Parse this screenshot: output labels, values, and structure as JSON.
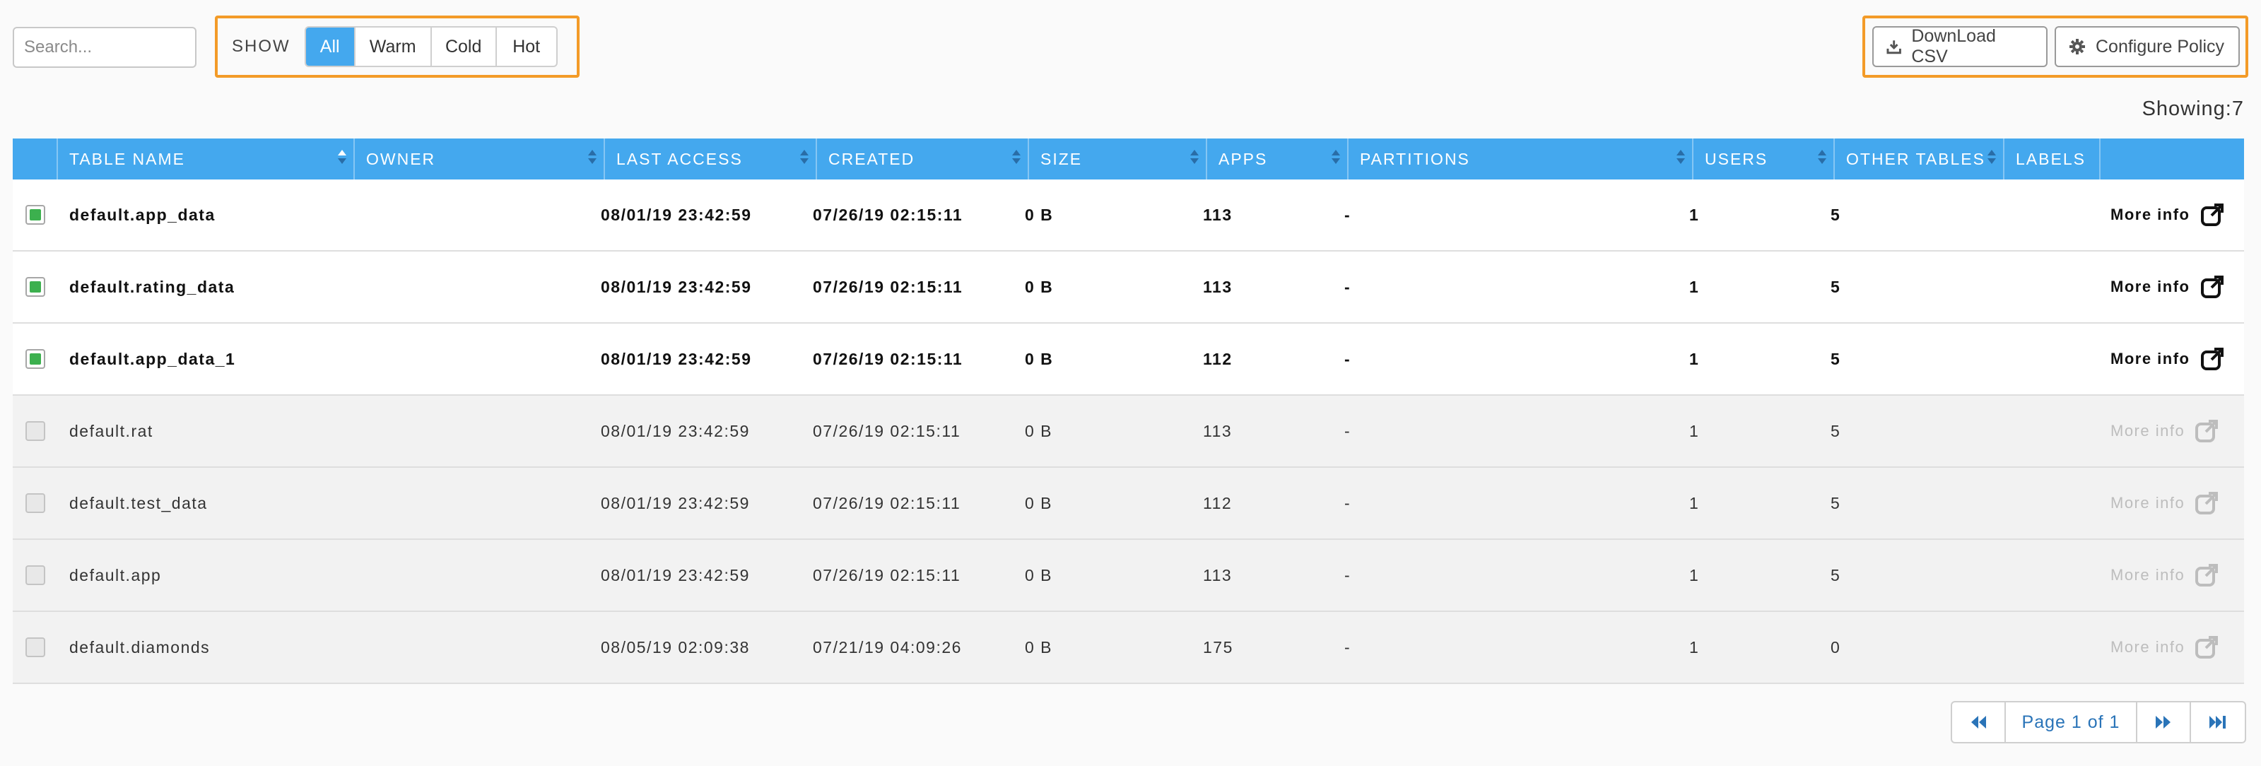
{
  "toolbar": {
    "search_placeholder": "Search...",
    "show_label": "SHOW",
    "filters": [
      {
        "label": "All",
        "active": true
      },
      {
        "label": "Warm",
        "active": false
      },
      {
        "label": "Cold",
        "active": false
      },
      {
        "label": "Hot",
        "active": false
      }
    ],
    "download_label": "DownLoad CSV",
    "configure_label": "Configure Policy",
    "download_icon": "download-icon",
    "configure_icon": "gear-icon"
  },
  "showing": "Showing:7",
  "table": {
    "columns": [
      "TABLE NAME",
      "OWNER",
      "LAST ACCESS",
      "CREATED",
      "SIZE",
      "APPS",
      "PARTITIONS",
      "USERS",
      "OTHER TABLES",
      "LABELS"
    ],
    "more_info_label": "More info",
    "rows": [
      {
        "selected": true,
        "name": "default.app_data",
        "owner": "",
        "last_access": "08/01/19 23:42:59",
        "created": "07/26/19 02:15:11",
        "size": "0 B",
        "apps": "113",
        "partitions": "-",
        "users": "1",
        "other_tables": "5",
        "labels": ""
      },
      {
        "selected": true,
        "name": "default.rating_data",
        "owner": "",
        "last_access": "08/01/19 23:42:59",
        "created": "07/26/19 02:15:11",
        "size": "0 B",
        "apps": "113",
        "partitions": "-",
        "users": "1",
        "other_tables": "5",
        "labels": ""
      },
      {
        "selected": true,
        "name": "default.app_data_1",
        "owner": "",
        "last_access": "08/01/19 23:42:59",
        "created": "07/26/19 02:15:11",
        "size": "0 B",
        "apps": "112",
        "partitions": "-",
        "users": "1",
        "other_tables": "5",
        "labels": ""
      },
      {
        "selected": false,
        "name": "default.rat",
        "owner": "",
        "last_access": "08/01/19 23:42:59",
        "created": "07/26/19 02:15:11",
        "size": "0 B",
        "apps": "113",
        "partitions": "-",
        "users": "1",
        "other_tables": "5",
        "labels": ""
      },
      {
        "selected": false,
        "name": "default.test_data",
        "owner": "",
        "last_access": "08/01/19 23:42:59",
        "created": "07/26/19 02:15:11",
        "size": "0 B",
        "apps": "112",
        "partitions": "-",
        "users": "1",
        "other_tables": "5",
        "labels": ""
      },
      {
        "selected": false,
        "name": "default.app",
        "owner": "",
        "last_access": "08/01/19 23:42:59",
        "created": "07/26/19 02:15:11",
        "size": "0 B",
        "apps": "113",
        "partitions": "-",
        "users": "1",
        "other_tables": "5",
        "labels": ""
      },
      {
        "selected": false,
        "name": "default.diamonds",
        "owner": "",
        "last_access": "08/05/19 02:09:38",
        "created": "07/21/19 04:09:26",
        "size": "0 B",
        "apps": "175",
        "partitions": "-",
        "users": "1",
        "other_tables": "0",
        "labels": ""
      }
    ]
  },
  "pagination": {
    "page_label": "Page 1 of 1",
    "first_icon": "first-page-icon",
    "next_icon": "next-page-icon",
    "last_icon": "last-page-icon"
  },
  "colors": {
    "accent": "#44a8ee",
    "highlight_border": "#f39b28",
    "checkbox_checked": "#3cb04e",
    "pager_text": "#2a74b8"
  }
}
